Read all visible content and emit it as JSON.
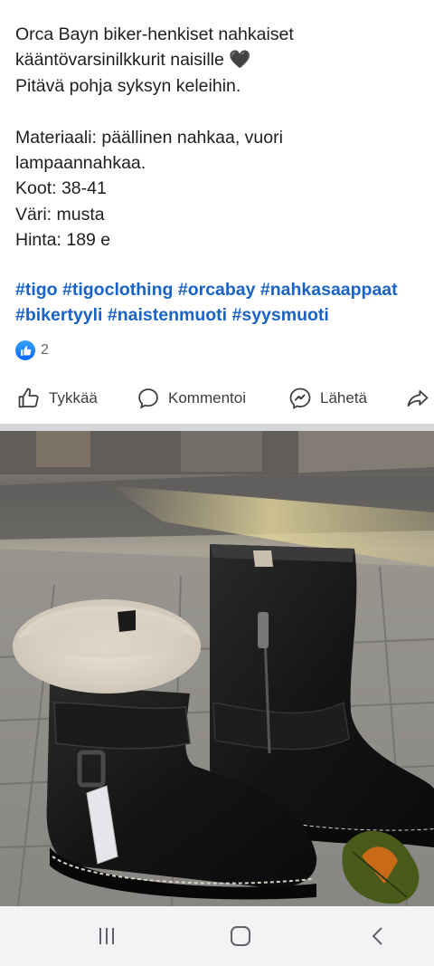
{
  "post": {
    "lines": [
      "Orca Bayn biker-henkiset nahkaiset",
      "kääntövarsinilkkurit naisille 🖤",
      "Pitävä pohja syksyn keleihin.",
      "",
      "Materiaali: päällinen nahkaa, vuori",
      "lampaannahkaa.",
      "Koot: 38-41",
      "Väri: musta",
      "Hinta: 189 e"
    ],
    "hashtag_lines": [
      [
        "#tigo",
        "#tigoclothing",
        "#orcabay",
        "#nahkasaappaat"
      ],
      [
        "#bikertyyli",
        "#naistenmuoti",
        "#syysmuoti"
      ]
    ]
  },
  "reactions": {
    "count": "2",
    "icon": "thumbs-up-icon",
    "color": "#0866ff"
  },
  "actions": {
    "like": "Tykkää",
    "comment": "Kommentoi",
    "send": "Lähetä"
  },
  "photo": {
    "subject": "black leather ankle boots with sheepskin cuff on paving stones"
  },
  "navbar": {
    "recent": "recent-apps-icon",
    "home": "home-icon",
    "back": "back-icon"
  }
}
